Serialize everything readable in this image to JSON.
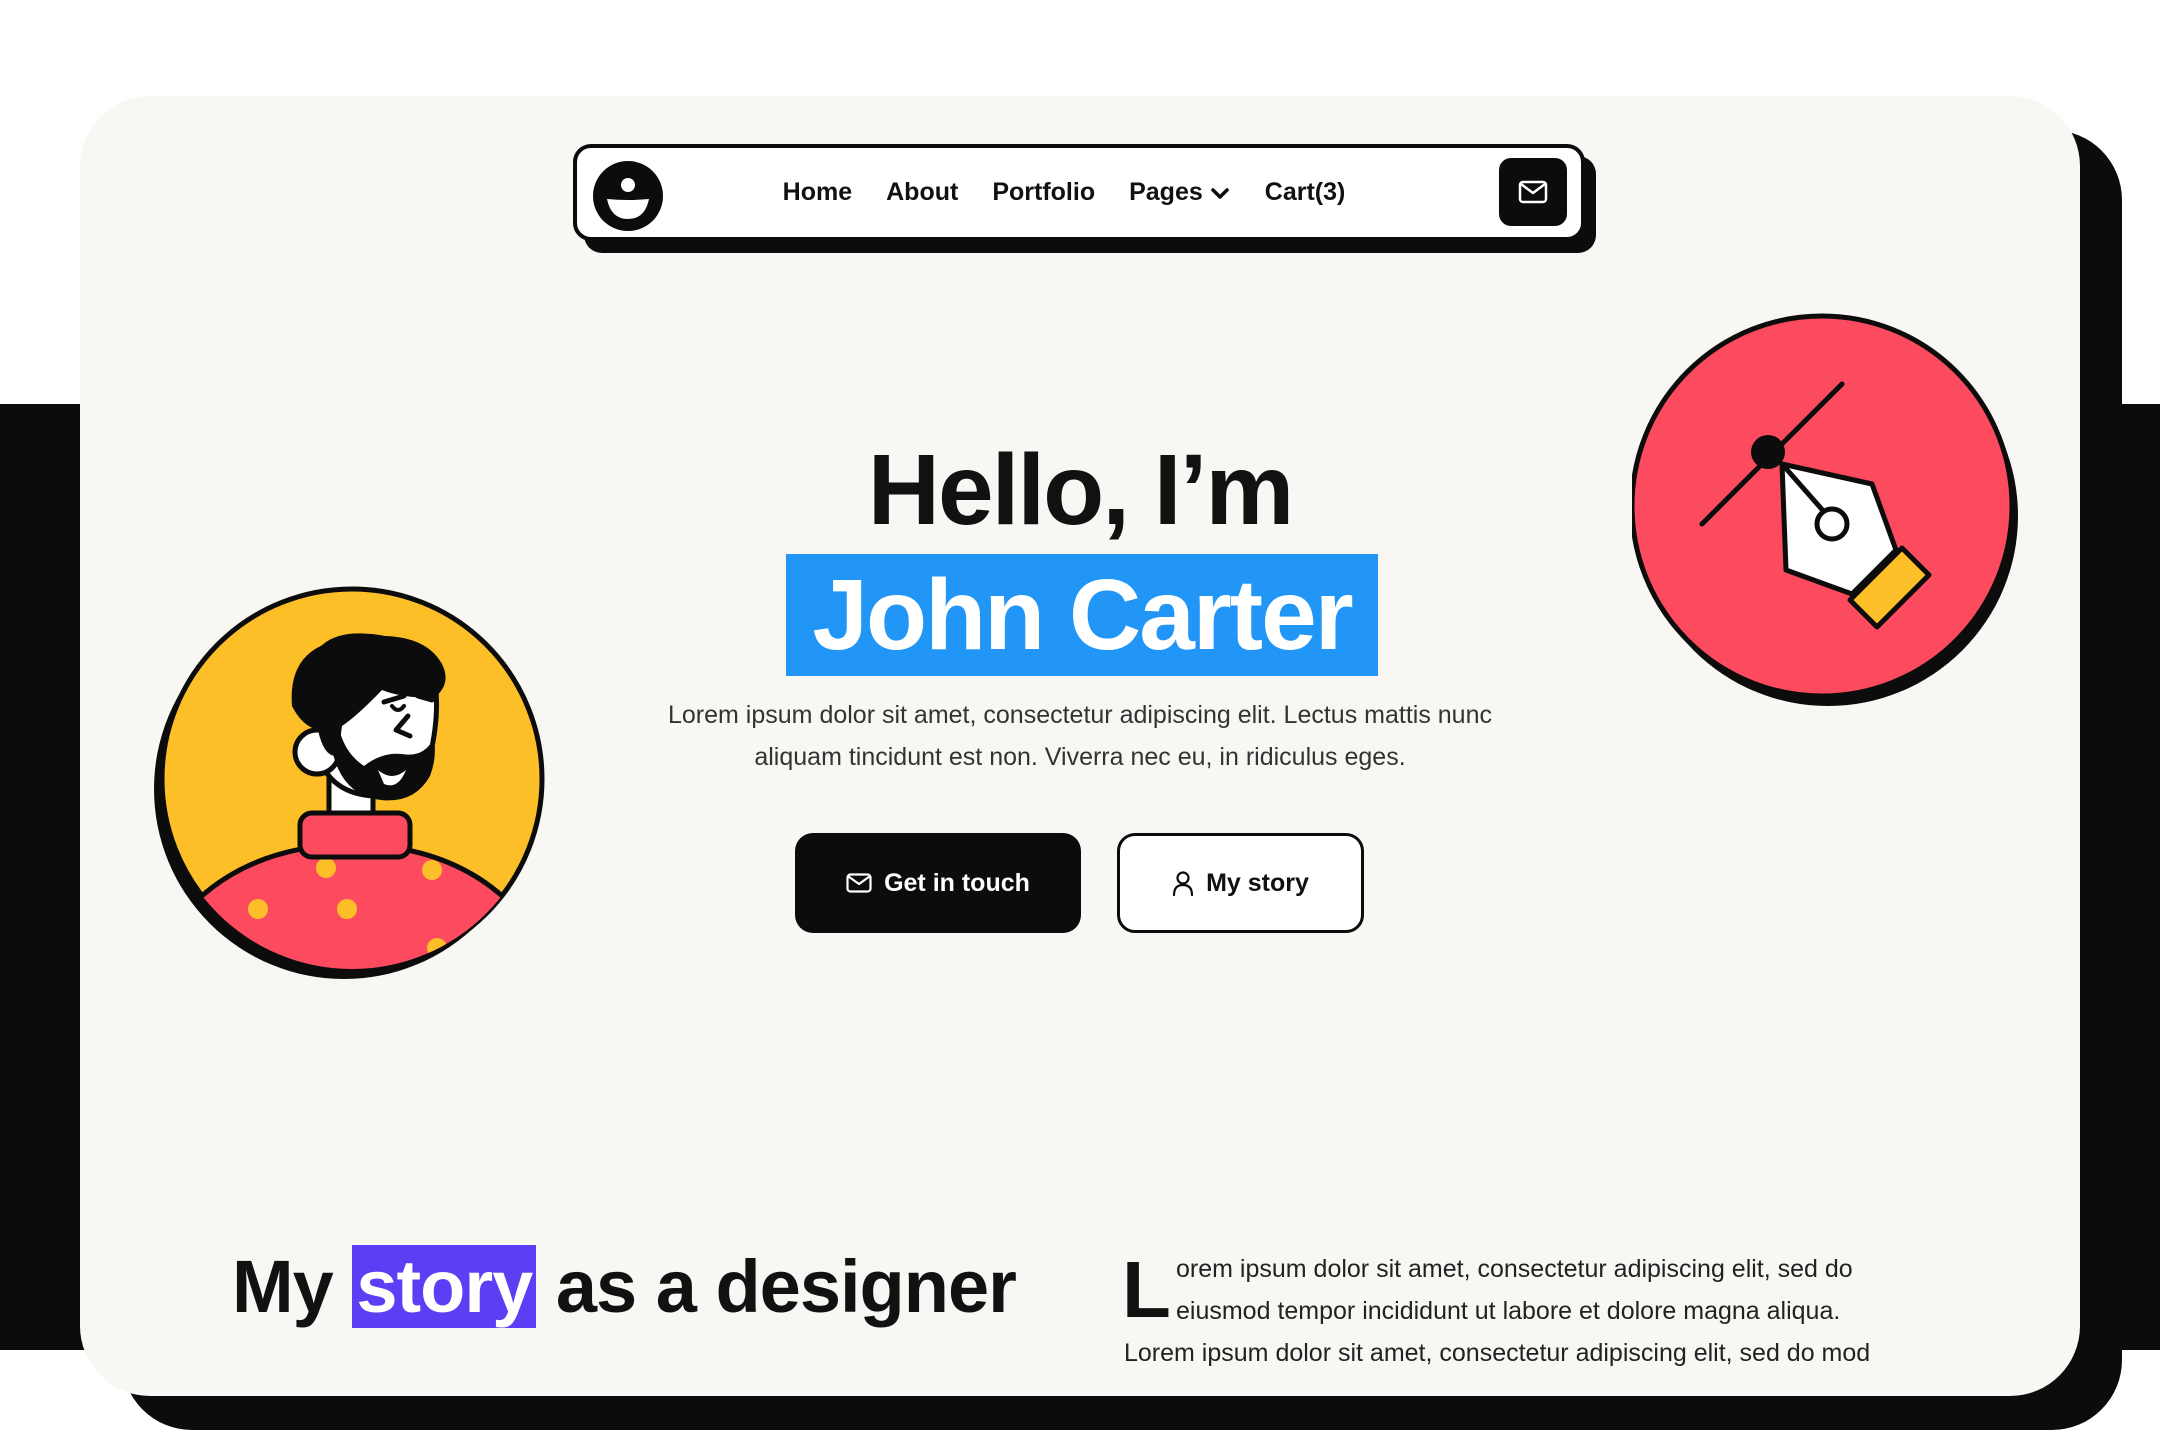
{
  "nav": {
    "items": [
      "Home",
      "About",
      "Portfolio",
      "Pages",
      "Cart(3)"
    ],
    "logo_icon": "smiley-logo-icon",
    "mail_icon": "mail-icon"
  },
  "hero": {
    "greeting": "Hello, I’m",
    "name": "John Carter",
    "description": "Lorem ipsum dolor sit amet, consectetur adipiscing elit. Lectus mattis nunc aliquam tincidunt est non. Viverra nec eu, in ridiculus eges.",
    "primary_button": "Get in touch",
    "secondary_button": "My story"
  },
  "story": {
    "title_before": "My",
    "title_highlight": "story",
    "title_after": "as a designer",
    "drop_cap": "L",
    "paragraph_line1": "orem ipsum dolor sit amet, consectetur adipiscing elit, sed do eiusmod tempor incididunt ut labore et dolore magna aliqua.",
    "paragraph_line2": "Lorem ipsum dolor sit amet, consectetur adipiscing elit, sed do mod"
  },
  "colors": {
    "accent_blue": "#2196f7",
    "accent_purple": "#5a3ff5",
    "yellow": "#fdbf27",
    "red": "#fc4a5e",
    "dark": "#0c0c0c"
  }
}
